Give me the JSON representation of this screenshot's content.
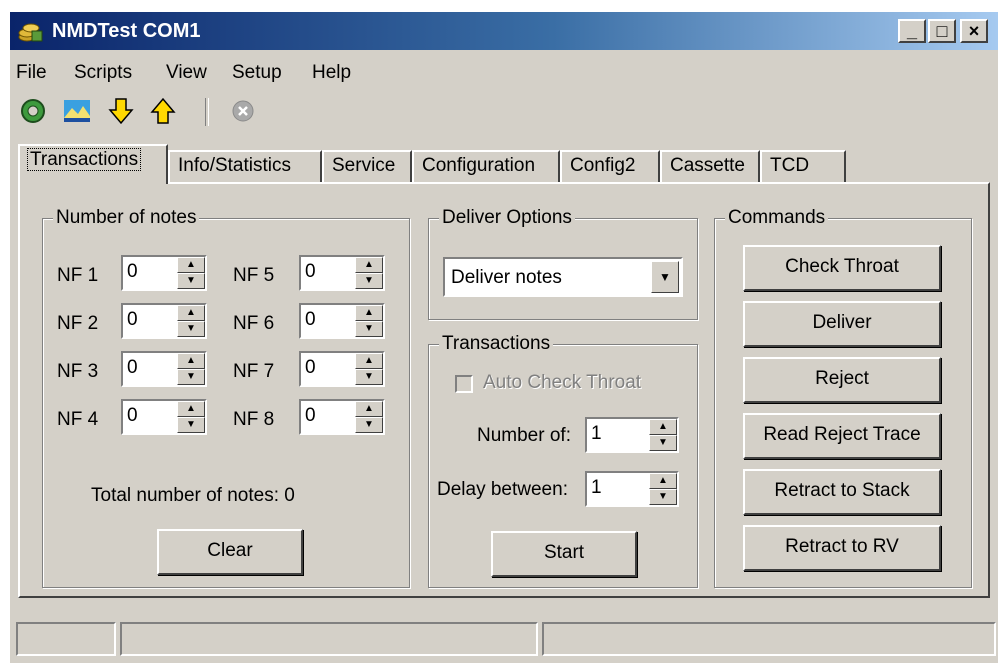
{
  "window": {
    "title": "NMDTest COM1",
    "minimize": "_",
    "maximize": "□",
    "close": "×"
  },
  "menu": [
    "File",
    "Scripts",
    "View",
    "Setup",
    "Help"
  ],
  "tabs": [
    "Transactions",
    "Info/Statistics",
    "Service",
    "Configuration",
    "Config2",
    "Cassette",
    "TCD"
  ],
  "notes": {
    "title": "Number of notes",
    "fields": [
      {
        "label": "NF 1",
        "value": "0"
      },
      {
        "label": "NF 2",
        "value": "0"
      },
      {
        "label": "NF 3",
        "value": "0"
      },
      {
        "label": "NF 4",
        "value": "0"
      },
      {
        "label": "NF 5",
        "value": "0"
      },
      {
        "label": "NF 6",
        "value": "0"
      },
      {
        "label": "NF 7",
        "value": "0"
      },
      {
        "label": "NF 8",
        "value": "0"
      }
    ],
    "total": "Total number of notes:  0",
    "clear": "Clear"
  },
  "deliver": {
    "title": "Deliver Options",
    "selected": "Deliver notes"
  },
  "transactions": {
    "title": "Transactions",
    "auto_check": "Auto Check Throat",
    "number_label": "Number of:",
    "number_value": "1",
    "delay_label": "Delay between:",
    "delay_value": "1",
    "start": "Start"
  },
  "commands": {
    "title": "Commands",
    "buttons": [
      "Check Throat",
      "Deliver",
      "Reject",
      "Read Reject Trace",
      "Retract to Stack",
      "Retract to RV"
    ]
  },
  "icons": [
    "refresh-icon",
    "landscape-icon",
    "arrow-down-icon",
    "arrow-up-icon",
    "stop-icon"
  ]
}
